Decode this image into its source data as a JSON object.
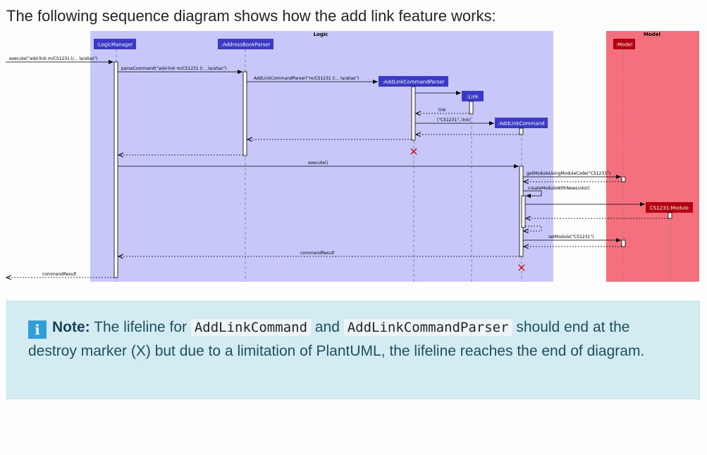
{
  "intro": "The following sequence diagram shows how the add link feature works:",
  "diagram": {
    "boxes": {
      "logic": "Logic",
      "model": "Model"
    },
    "participants": {
      "logic_manager": ":LogicManager",
      "address_book_parser": ":AddressBookParser",
      "add_link_command_parser": ":AddLinkCommandParser",
      "link": ":Link",
      "add_link_command": ":AddLinkCommand",
      "model": ":Model",
      "module": "CS1231:Module"
    },
    "messages": {
      "execute_call": "execute(\"add-link m/CS1231 l/... la/alias\")",
      "parse_command": "parseCommand(\"add-link m/CS1231 l/... la/alias\")",
      "add_link_parser_create": "AddLinkCommandParser(\"m/CS1231 l/... la/alias\")",
      "link_return": "link",
      "add_link_command_create": "(\"CS1231\", link)",
      "execute": "execute()",
      "get_module": "getModuleUsingModuleCode(\"CS1231\")",
      "create_module": "createModuleWithNewLinks()",
      "set_module": "setModule(\"CS1231\")",
      "command_result_inner": "commandResult",
      "command_result_outer": "commandResult"
    },
    "destroy_marker": "×"
  },
  "note": {
    "icon": "i",
    "label": "Note:",
    "text_1": " The lifeline for ",
    "code_1": "AddLinkCommand",
    "text_2": " and ",
    "code_2": "AddLinkCommandParser",
    "text_3": " should end at the destroy marker (X) but due to a limitation of PlantUML, the lifeline reaches the end of diagram."
  }
}
